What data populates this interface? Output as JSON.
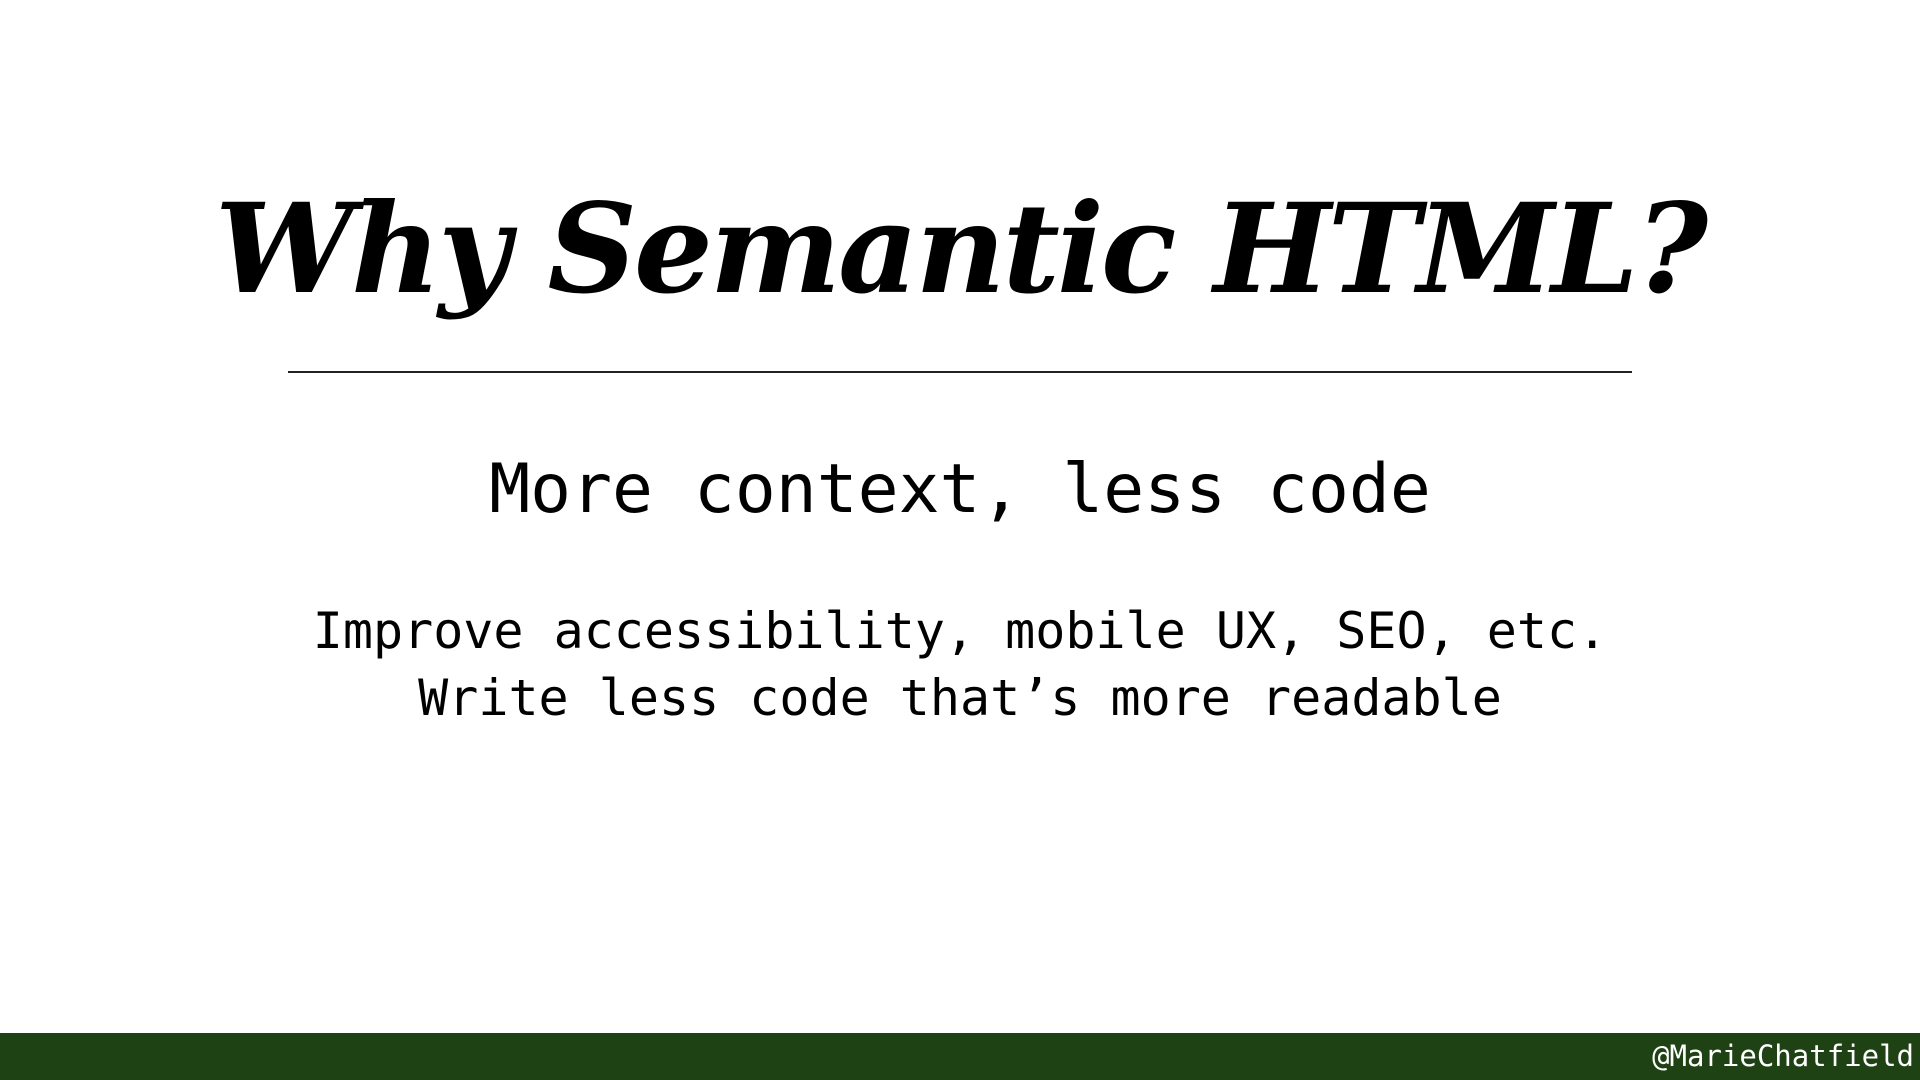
{
  "slide": {
    "title": "Why Semantic HTML?",
    "subtitle": "More context, less code",
    "points": [
      "Improve accessibility, mobile UX, SEO, etc.",
      "Write less code that’s more readable"
    ]
  },
  "footer": {
    "handle": "@MarieChatfield"
  },
  "colors": {
    "background": "#ffffff",
    "text": "#000000",
    "footer_bar": "#1f4215",
    "footer_text": "#ffffff"
  }
}
